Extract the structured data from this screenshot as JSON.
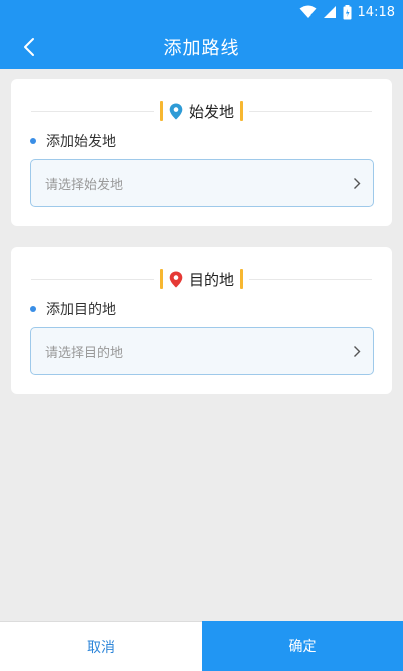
{
  "status_bar": {
    "time": "14:18",
    "icons": [
      "wifi-icon",
      "signal-icon",
      "battery-icon"
    ]
  },
  "app_bar": {
    "title": "添加路线",
    "back_icon": "back-arrow-icon"
  },
  "origin_card": {
    "header": "始发地",
    "section_label": "添加始发地",
    "placeholder": "请选择始发地",
    "pin_color": "#2e9bd6"
  },
  "destination_card": {
    "header": "目的地",
    "section_label": "添加目的地",
    "placeholder": "请选择目的地",
    "pin_color": "#e53935"
  },
  "actions": {
    "cancel_label": "取消",
    "confirm_label": "确定"
  },
  "colors": {
    "primary": "#2196f3",
    "accent_bar": "#f7b731",
    "background": "#ececec"
  }
}
